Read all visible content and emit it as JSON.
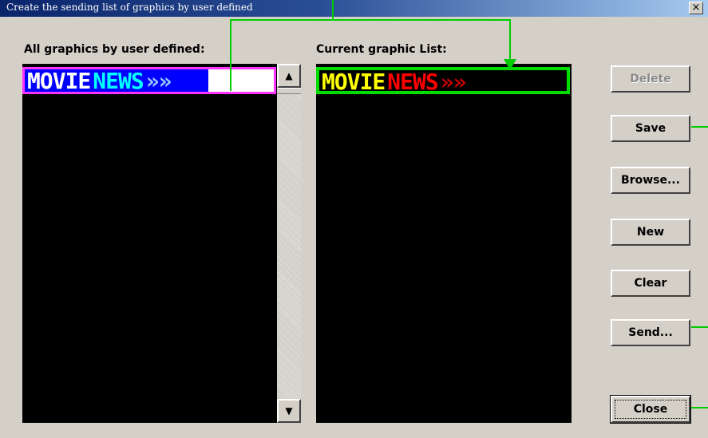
{
  "window": {
    "title": "Create the sending list of graphics by user defined",
    "close_glyph": "×"
  },
  "left_list": {
    "label": "All graphics by user defined:",
    "items": [
      {
        "word1": "MOVIE",
        "word2": "NEWS",
        "arrows": "»»",
        "colors": {
          "word1": "#ffffff",
          "word2": "#00ffff",
          "arrows": "#99ccff",
          "background": "#0000ff",
          "border": "#ff33ff"
        }
      }
    ]
  },
  "right_list": {
    "label": "Current graphic List:",
    "items": [
      {
        "word1": "MOVIE",
        "word2": "NEWS",
        "arrows": "»»",
        "colors": {
          "word1": "#ffff00",
          "word2": "#ff0000",
          "arrows": "#cc0000",
          "background": "#000000",
          "border": "#00dd00"
        }
      }
    ]
  },
  "scrollbar": {
    "up_glyph": "▲",
    "down_glyph": "▼"
  },
  "buttons": {
    "delete": "Delete",
    "save": "Save",
    "browse": "Browse...",
    "new": "New",
    "clear": "Clear",
    "send": "Send...",
    "close": "Close"
  },
  "colors": {
    "dialog_bg": "#d4d0c8",
    "callout": "#00cc00",
    "titlebar": "#0a246a"
  }
}
